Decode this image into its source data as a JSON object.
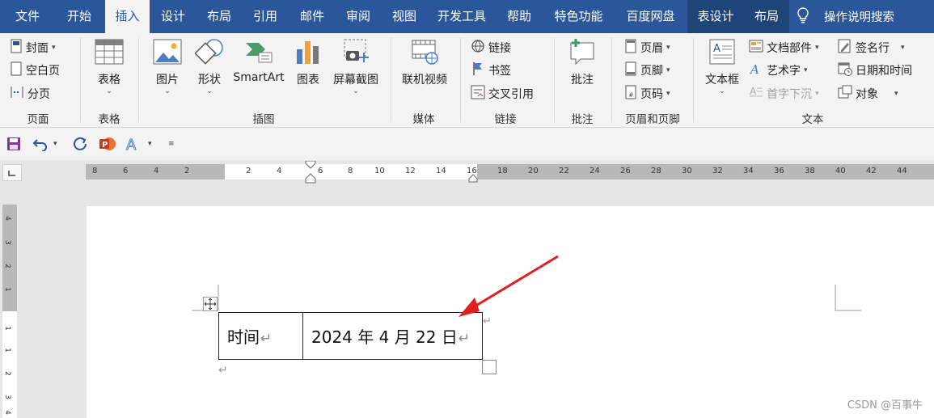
{
  "tabs": [
    "文件",
    "开始",
    "插入",
    "设计",
    "布局",
    "引用",
    "邮件",
    "审阅",
    "视图",
    "开发工具",
    "帮助",
    "特色功能",
    "百度网盘",
    "表设计",
    "布局"
  ],
  "active_tab": "插入",
  "tell_me": "操作说明搜索",
  "ribbon": {
    "pages": {
      "cover": "封面",
      "blank": "空白页",
      "break": "分页",
      "group": "页面"
    },
    "tables": {
      "table": "表格",
      "group": "表格"
    },
    "illustrations": {
      "pictures": "图片",
      "shapes": "形状",
      "smartart": "SmartArt",
      "chart": "图表",
      "screenshot": "屏幕截图",
      "group": "插图"
    },
    "media": {
      "online_video": "联机视频",
      "group": "媒体"
    },
    "links": {
      "link": "链接",
      "bookmark": "书签",
      "cross_ref": "交叉引用",
      "group": "链接"
    },
    "comments": {
      "comment": "批注",
      "group": "批注"
    },
    "header_footer": {
      "header": "页眉",
      "footer": "页脚",
      "page_number": "页码",
      "group": "页眉和页脚"
    },
    "text": {
      "textbox": "文本框",
      "quick_parts": "文档部件",
      "wordart": "艺术字",
      "drop_cap": "首字下沉",
      "signature": "签名行",
      "datetime": "日期和时间",
      "object": "对象",
      "group": "文本"
    }
  },
  "ruler": {
    "left_ticks": [
      "8",
      "6",
      "4",
      "2"
    ],
    "white_ticks": [
      "2",
      "4",
      "6",
      "8"
    ],
    "right_ticks": [
      "10",
      "12",
      "14",
      "16",
      "18",
      "20",
      "22",
      "24",
      "26",
      "28",
      "30",
      "32",
      "34",
      "36",
      "38",
      "40",
      "42",
      "44"
    ],
    "v_ticks": [
      "4",
      "3",
      "2",
      "1",
      "1",
      "1",
      "2",
      "3",
      "4"
    ]
  },
  "document": {
    "table": [
      [
        "时间",
        "2024 年 4 月 22 日"
      ]
    ]
  },
  "colors": {
    "title_blue": "#2b579a",
    "context_tab": "#1f4478",
    "arrow": "#e02020"
  },
  "watermark": "CSDN @百事牛"
}
